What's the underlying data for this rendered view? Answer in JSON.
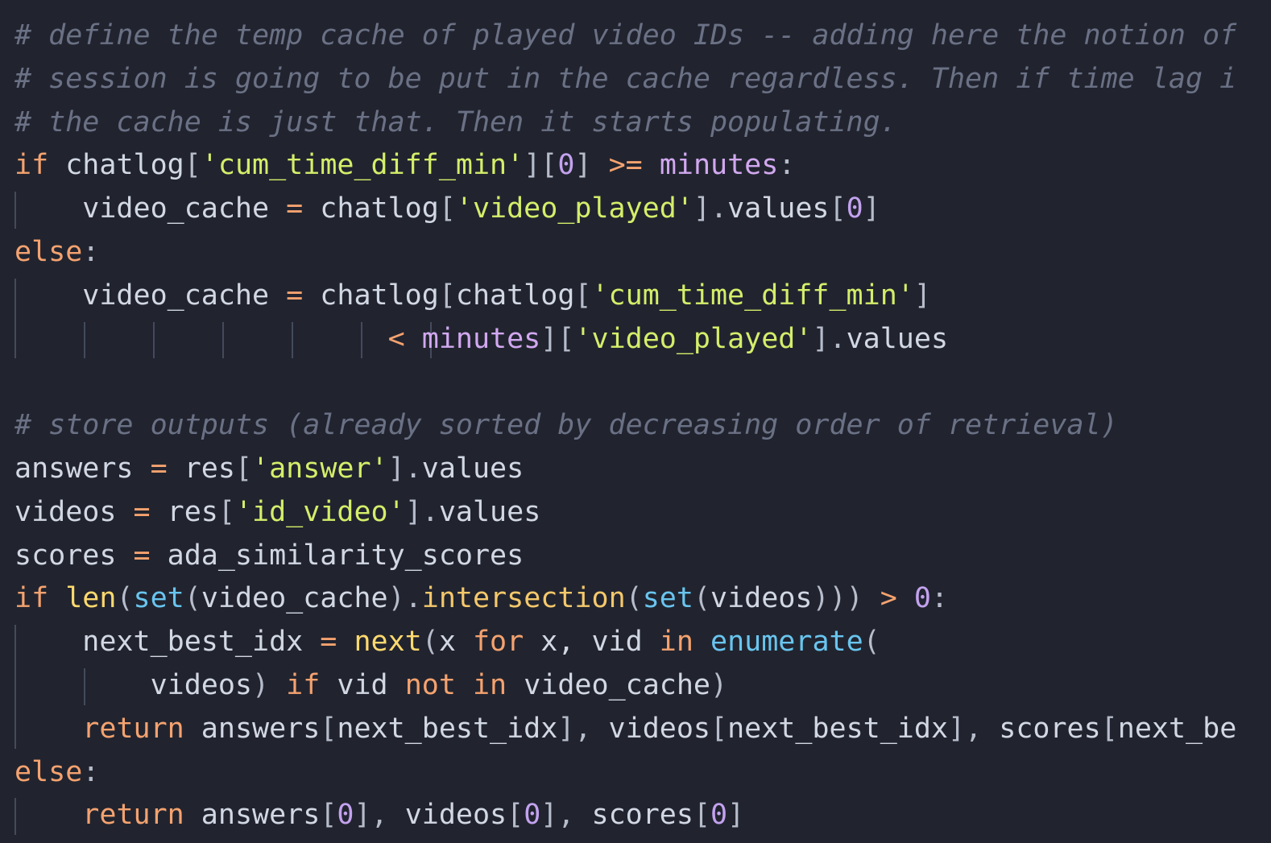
{
  "colors": {
    "background": "#21242f",
    "indent_guide": "#444a5c",
    "plain": "#d2d7e4",
    "comment": "#6b7185",
    "keyword": "#f5a26f",
    "string": "#d4ee6a",
    "number": "#c3a2ee",
    "builtin": "#ffd96e",
    "call": "#f5c86b",
    "type": "#69c5ef",
    "variable": "#d2a8f0",
    "punct": "#b7bccb"
  },
  "code": {
    "lines": [
      {
        "tokens": [
          {
            "text": "# define the temp cache of played video IDs -- adding here the notion of",
            "type": "comment"
          }
        ]
      },
      {
        "tokens": [
          {
            "text": "# session is going to be put in the cache regardless. Then if time lag i",
            "type": "comment"
          }
        ]
      },
      {
        "tokens": [
          {
            "text": "# the cache is just that. Then it starts populating.",
            "type": "comment"
          }
        ]
      },
      {
        "tokens": [
          {
            "text": "if",
            "type": "keyword"
          },
          {
            "text": " chatlog",
            "type": "plain"
          },
          {
            "text": "[",
            "type": "punct"
          },
          {
            "text": "'cum_time_diff_min'",
            "type": "string"
          },
          {
            "text": "][",
            "type": "punct"
          },
          {
            "text": "0",
            "type": "number"
          },
          {
            "text": "]",
            "type": "punct"
          },
          {
            "text": " ",
            "type": "plain"
          },
          {
            "text": ">=",
            "type": "keyword"
          },
          {
            "text": " ",
            "type": "plain"
          },
          {
            "text": "minutes",
            "type": "variable"
          },
          {
            "text": ":",
            "type": "punct"
          }
        ]
      },
      {
        "tokens": [
          {
            "text": "    video_cache ",
            "type": "plain"
          },
          {
            "text": "=",
            "type": "keyword"
          },
          {
            "text": " chatlog",
            "type": "plain"
          },
          {
            "text": "[",
            "type": "punct"
          },
          {
            "text": "'video_played'",
            "type": "string"
          },
          {
            "text": "].",
            "type": "punct"
          },
          {
            "text": "values",
            "type": "plain"
          },
          {
            "text": "[",
            "type": "punct"
          },
          {
            "text": "0",
            "type": "number"
          },
          {
            "text": "]",
            "type": "punct"
          }
        ]
      },
      {
        "tokens": [
          {
            "text": "else",
            "type": "keyword"
          },
          {
            "text": ":",
            "type": "punct"
          }
        ]
      },
      {
        "tokens": [
          {
            "text": "    video_cache ",
            "type": "plain"
          },
          {
            "text": "=",
            "type": "keyword"
          },
          {
            "text": " chatlog",
            "type": "plain"
          },
          {
            "text": "[",
            "type": "punct"
          },
          {
            "text": "chatlog",
            "type": "plain"
          },
          {
            "text": "[",
            "type": "punct"
          },
          {
            "text": "'cum_time_diff_min'",
            "type": "string"
          },
          {
            "text": "]",
            "type": "punct"
          }
        ]
      },
      {
        "tokens": [
          {
            "text": "                      ",
            "type": "plain"
          },
          {
            "text": "<",
            "type": "keyword"
          },
          {
            "text": " ",
            "type": "plain"
          },
          {
            "text": "minutes",
            "type": "variable"
          },
          {
            "text": "][",
            "type": "punct"
          },
          {
            "text": "'video_played'",
            "type": "string"
          },
          {
            "text": "].",
            "type": "punct"
          },
          {
            "text": "values",
            "type": "plain"
          }
        ]
      },
      {
        "tokens": []
      },
      {
        "tokens": [
          {
            "text": "# store outputs (already sorted by decreasing order of retrieval)",
            "type": "comment"
          }
        ]
      },
      {
        "tokens": [
          {
            "text": "answers ",
            "type": "plain"
          },
          {
            "text": "=",
            "type": "keyword"
          },
          {
            "text": " res",
            "type": "plain"
          },
          {
            "text": "[",
            "type": "punct"
          },
          {
            "text": "'answer'",
            "type": "string"
          },
          {
            "text": "].",
            "type": "punct"
          },
          {
            "text": "values",
            "type": "plain"
          }
        ]
      },
      {
        "tokens": [
          {
            "text": "videos ",
            "type": "plain"
          },
          {
            "text": "=",
            "type": "keyword"
          },
          {
            "text": " res",
            "type": "plain"
          },
          {
            "text": "[",
            "type": "punct"
          },
          {
            "text": "'id_video'",
            "type": "string"
          },
          {
            "text": "].",
            "type": "punct"
          },
          {
            "text": "values",
            "type": "plain"
          }
        ]
      },
      {
        "tokens": [
          {
            "text": "scores ",
            "type": "plain"
          },
          {
            "text": "=",
            "type": "keyword"
          },
          {
            "text": " ada_similarity_scores",
            "type": "plain"
          }
        ]
      },
      {
        "tokens": [
          {
            "text": "if",
            "type": "keyword"
          },
          {
            "text": " ",
            "type": "plain"
          },
          {
            "text": "len",
            "type": "builtin"
          },
          {
            "text": "(",
            "type": "punct"
          },
          {
            "text": "set",
            "type": "type"
          },
          {
            "text": "(",
            "type": "punct"
          },
          {
            "text": "video_cache",
            "type": "plain"
          },
          {
            "text": ").",
            "type": "punct"
          },
          {
            "text": "intersection",
            "type": "call"
          },
          {
            "text": "(",
            "type": "punct"
          },
          {
            "text": "set",
            "type": "type"
          },
          {
            "text": "(",
            "type": "punct"
          },
          {
            "text": "videos",
            "type": "plain"
          },
          {
            "text": ")))",
            "type": "punct"
          },
          {
            "text": " ",
            "type": "plain"
          },
          {
            "text": ">",
            "type": "keyword"
          },
          {
            "text": " ",
            "type": "plain"
          },
          {
            "text": "0",
            "type": "number"
          },
          {
            "text": ":",
            "type": "punct"
          }
        ]
      },
      {
        "tokens": [
          {
            "text": "    next_best_idx ",
            "type": "plain"
          },
          {
            "text": "=",
            "type": "keyword"
          },
          {
            "text": " ",
            "type": "plain"
          },
          {
            "text": "next",
            "type": "builtin"
          },
          {
            "text": "(",
            "type": "punct"
          },
          {
            "text": "x ",
            "type": "plain"
          },
          {
            "text": "for",
            "type": "keyword"
          },
          {
            "text": " x, vid ",
            "type": "plain"
          },
          {
            "text": "in",
            "type": "keyword"
          },
          {
            "text": " ",
            "type": "plain"
          },
          {
            "text": "enumerate",
            "type": "type"
          },
          {
            "text": "(",
            "type": "punct"
          }
        ]
      },
      {
        "tokens": [
          {
            "text": "        videos",
            "type": "plain"
          },
          {
            "text": ")",
            "type": "punct"
          },
          {
            "text": " ",
            "type": "plain"
          },
          {
            "text": "if",
            "type": "keyword"
          },
          {
            "text": " vid ",
            "type": "plain"
          },
          {
            "text": "not",
            "type": "keyword"
          },
          {
            "text": " ",
            "type": "plain"
          },
          {
            "text": "in",
            "type": "keyword"
          },
          {
            "text": " video_cache",
            "type": "plain"
          },
          {
            "text": ")",
            "type": "punct"
          }
        ]
      },
      {
        "tokens": [
          {
            "text": "    ",
            "type": "plain"
          },
          {
            "text": "return",
            "type": "keyword"
          },
          {
            "text": " answers",
            "type": "plain"
          },
          {
            "text": "[",
            "type": "punct"
          },
          {
            "text": "next_best_idx",
            "type": "plain"
          },
          {
            "text": "],",
            "type": "punct"
          },
          {
            "text": " videos",
            "type": "plain"
          },
          {
            "text": "[",
            "type": "punct"
          },
          {
            "text": "next_best_idx",
            "type": "plain"
          },
          {
            "text": "],",
            "type": "punct"
          },
          {
            "text": " scores",
            "type": "plain"
          },
          {
            "text": "[",
            "type": "punct"
          },
          {
            "text": "next_be",
            "type": "plain"
          }
        ]
      },
      {
        "tokens": [
          {
            "text": "else",
            "type": "keyword"
          },
          {
            "text": ":",
            "type": "punct"
          }
        ]
      },
      {
        "tokens": [
          {
            "text": "    ",
            "type": "plain"
          },
          {
            "text": "return",
            "type": "keyword"
          },
          {
            "text": " answers",
            "type": "plain"
          },
          {
            "text": "[",
            "type": "punct"
          },
          {
            "text": "0",
            "type": "number"
          },
          {
            "text": "],",
            "type": "punct"
          },
          {
            "text": " videos",
            "type": "plain"
          },
          {
            "text": "[",
            "type": "punct"
          },
          {
            "text": "0",
            "type": "number"
          },
          {
            "text": "],",
            "type": "punct"
          },
          {
            "text": " scores",
            "type": "plain"
          },
          {
            "text": "[",
            "type": "punct"
          },
          {
            "text": "0",
            "type": "number"
          },
          {
            "text": "]",
            "type": "punct"
          }
        ]
      }
    ]
  }
}
